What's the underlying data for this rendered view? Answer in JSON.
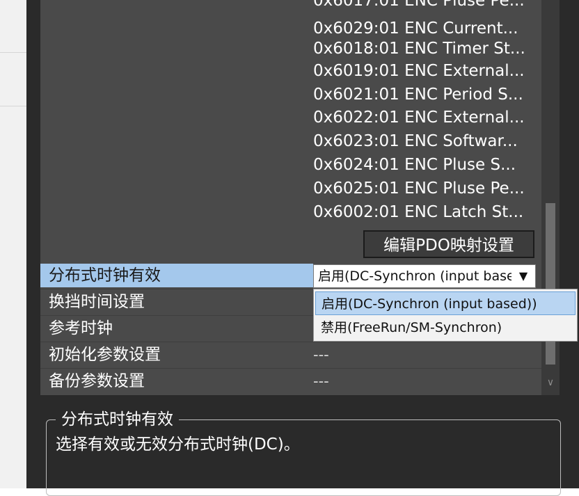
{
  "pdo_entries": [
    "0x6017:01 ENC Pluse Pe...",
    "0x6029:01 ENC Current...",
    "0x6018:01 ENC Timer St...",
    "0x6019:01 ENC External...",
    "0x6021:01 ENC Period S...",
    "0x6022:01 ENC External...",
    "0x6023:01 ENC Softwar...",
    "0x6024:01 ENC Pluse S...",
    "0x6025:01 ENC Pluse Pe...",
    "0x6002:01 ENC Latch St..."
  ],
  "edit_pdo_button": "编辑PDO映射设置",
  "properties": [
    {
      "label": "分布式时钟有效",
      "value": ""
    },
    {
      "label": "换挡时间设置",
      "value": ""
    },
    {
      "label": "参考时钟",
      "value": ""
    },
    {
      "label": "初始化参数设置",
      "value": "---"
    },
    {
      "label": "备份参数设置",
      "value": "---"
    }
  ],
  "dc_combo": {
    "selected": "启用(DC-Synchron (input based))",
    "arrow": "▼"
  },
  "dc_options": [
    "启用(DC-Synchron (input based))",
    "禁用(FreeRun/SM-Synchron)"
  ],
  "description": {
    "title": "分布式时钟有效",
    "text": "选择有效或无效分布式时钟(DC)。"
  },
  "colors": {
    "panel_bg": "#4a4a4a",
    "selected_row": "#a4c8ec",
    "dropdown_highlight": "#b9d5f2"
  },
  "icons": {
    "combo_arrow": "triangle-down",
    "scroll_down": "chevron-down"
  }
}
